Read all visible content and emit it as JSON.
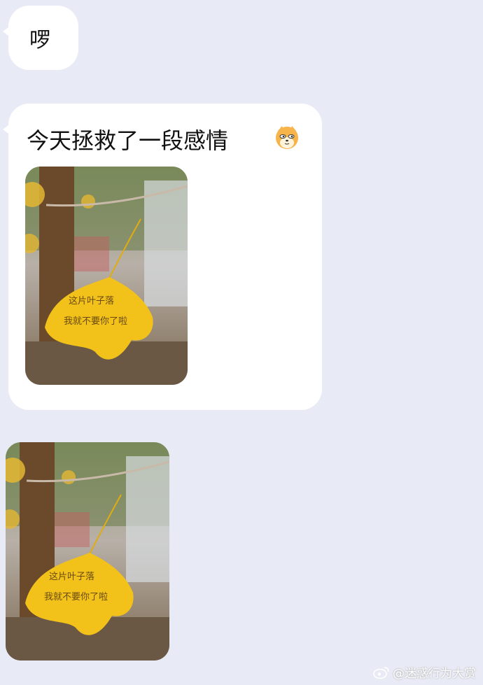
{
  "messages": [
    {
      "text": "啰"
    },
    {
      "text": "今天拯救了一段感情",
      "emoji": "fox-face-emoji"
    }
  ],
  "photo_caption": "这片叶子落了我就不要你了啦",
  "watermark": "@迷惑行为大赏",
  "colors": {
    "background": "#e8ebf5",
    "bubble": "#ffffff",
    "leaf": "#f2c21b"
  }
}
